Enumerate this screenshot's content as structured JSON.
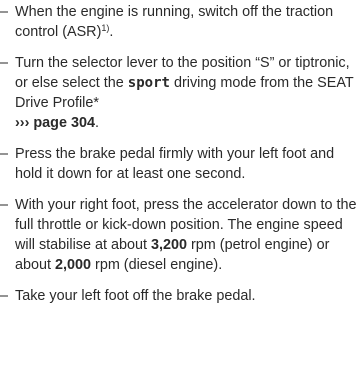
{
  "steps": [
    {
      "dash": "–",
      "text_a": "When the engine is running, switch off the traction control (ASR)",
      "footnote": "1)",
      "text_b": "."
    },
    {
      "dash": "–",
      "text_a": "Turn the selector lever to the position “S” or tiptronic, or else select the ",
      "keyword": "sport",
      "text_b": " driving mode from the SEAT Drive Profile*",
      "xref": "››› page 304",
      "text_c": "."
    },
    {
      "dash": "–",
      "text_a": "Press the brake pedal firmly with your left foot and hold it down for at least one sec­ond."
    },
    {
      "dash": "–",
      "text_a": "With your right foot, press the accelerator down to the full throttle or kick-down posi­tion. The engine speed will stabilise at about ",
      "val1": "3,200",
      "text_b": " rpm (petrol engine) or about ",
      "val2": "2,000",
      "text_c": " rpm (diesel engine)."
    },
    {
      "dash": "–",
      "text_a": "Take your left foot off the brake pedal."
    }
  ]
}
